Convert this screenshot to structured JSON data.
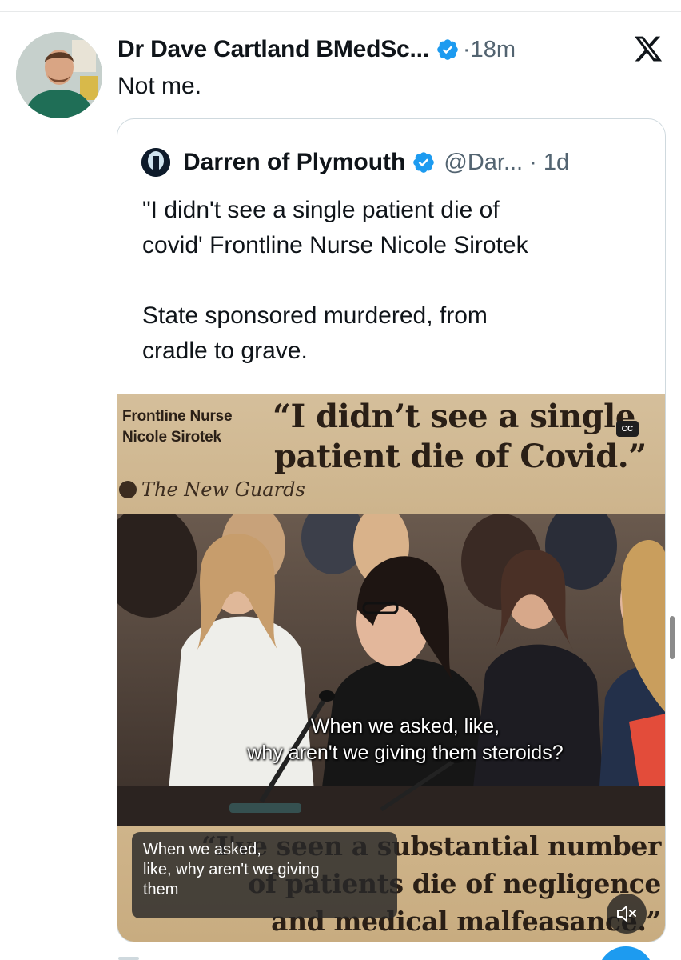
{
  "tweet": {
    "author_name": "Dr Dave Cartland BMedSc...",
    "time": "18m",
    "text": "Not me."
  },
  "quoted": {
    "author_name": "Darren of Plymouth",
    "handle": "@Dar...",
    "time": "1d",
    "text_line1": "\"I didn't see a single patient die of",
    "text_line2": "covid' Frontline Nurse Nicole Sirotek",
    "text_line3": "State sponsored murdered, from",
    "text_line4": "cradle to grave."
  },
  "media": {
    "banner_label_line1": "Frontline Nurse",
    "banner_label_line2": "Nicole Sirotek",
    "banner_quote_line1": "“I didn’t see a single",
    "banner_quote_line2": "patient die of Covid.”",
    "brand": "The New Guards",
    "cc_label": "CC",
    "subtitle_line1": "When we asked, like,",
    "subtitle_line2": "why aren't we giving them steroids?",
    "bottom_quote_line1": "“I've seen a substantial number",
    "bottom_quote_line2": "of patients die of negligence",
    "bottom_quote_line3": "and medical malfeasance.”",
    "caption_line1": "When we asked,",
    "caption_line2": "like, why aren't we giving",
    "caption_line3": "them"
  },
  "icons": {
    "verified": "verified-badge-icon",
    "x_logo": "x-logo-icon",
    "mute": "mute-icon",
    "cc": "closed-captions-icon"
  },
  "colors": {
    "verified_blue": "#1d9bf0",
    "secondary_text": "#536471",
    "border": "#cfd9de"
  }
}
